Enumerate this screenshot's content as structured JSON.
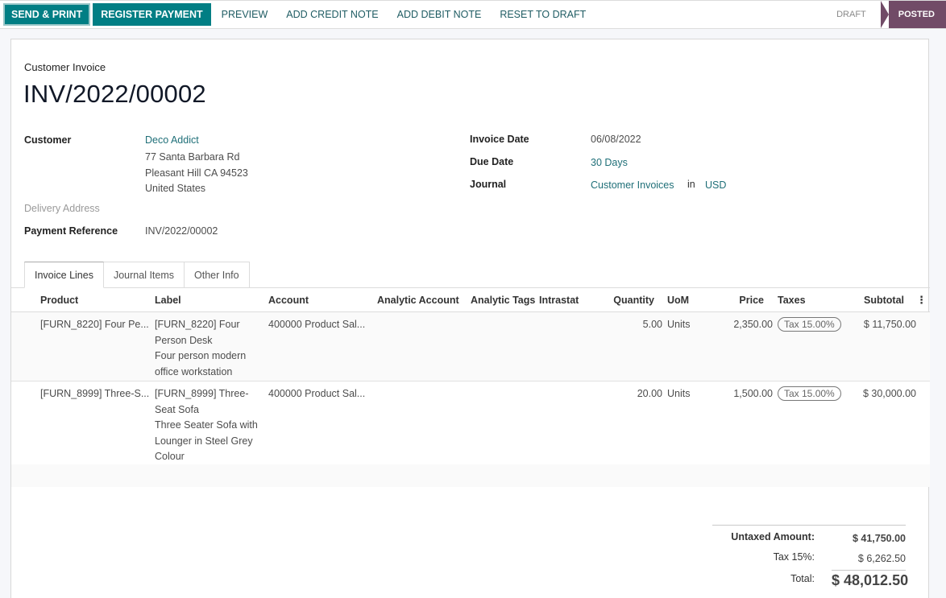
{
  "toolbar": {
    "send_print": "SEND & PRINT",
    "register_payment": "REGISTER PAYMENT",
    "preview": "PREVIEW",
    "add_credit_note": "ADD CREDIT NOTE",
    "add_debit_note": "ADD DEBIT NOTE",
    "reset_to_draft": "RESET TO DRAFT",
    "status_steps": [
      {
        "label": "DRAFT",
        "active": false
      },
      {
        "label": "POSTED",
        "active": true
      }
    ],
    "colors": {
      "primary": "#017e84",
      "status_active": "#714b67"
    }
  },
  "header": {
    "doc_type": "Customer Invoice",
    "title": "INV/2022/00002"
  },
  "fields": {
    "customer_label": "Customer",
    "customer_name": "Deco Addict",
    "address": [
      "77 Santa Barbara Rd",
      "Pleasant Hill CA 94523",
      "United States"
    ],
    "delivery_address_label": "Delivery Address",
    "payment_reference_label": "Payment Reference",
    "payment_reference": "INV/2022/00002",
    "invoice_date_label": "Invoice Date",
    "invoice_date": "06/08/2022",
    "due_date_label": "Due Date",
    "due_date": "30 Days",
    "journal_label": "Journal",
    "journal": "Customer Invoices",
    "journal_in": "in",
    "currency": "USD"
  },
  "tabs": [
    {
      "label": "Invoice Lines",
      "active": true
    },
    {
      "label": "Journal Items",
      "active": false
    },
    {
      "label": "Other Info",
      "active": false
    }
  ],
  "table": {
    "columns": [
      "Product",
      "Label",
      "Account",
      "Analytic Account",
      "Analytic Tags",
      "Intrastat",
      "Quantity",
      "UoM",
      "Price",
      "Taxes",
      "Subtotal"
    ],
    "rows": [
      {
        "product": "[FURN_8220] Four Pe...",
        "label": [
          "[FURN_8220] Four",
          "Person Desk",
          "Four person modern",
          "office workstation"
        ],
        "account": "400000 Product Sal...",
        "analytic_account": "",
        "analytic_tags": "",
        "intrastat": "",
        "quantity": "5.00",
        "uom": "Units",
        "price": "2,350.00",
        "taxes": "Tax 15.00%",
        "subtotal": "$ 11,750.00"
      },
      {
        "product": "[FURN_8999] Three-S...",
        "label": [
          "[FURN_8999] Three-",
          "Seat Sofa",
          "Three Seater Sofa with",
          "Lounger in Steel Grey",
          "Colour"
        ],
        "account": "400000 Product Sal...",
        "analytic_account": "",
        "analytic_tags": "",
        "intrastat": "",
        "quantity": "20.00",
        "uom": "Units",
        "price": "1,500.00",
        "taxes": "Tax 15.00%",
        "subtotal": "$ 30,000.00"
      }
    ]
  },
  "totals": {
    "untaxed_label": "Untaxed Amount:",
    "untaxed": "$ 41,750.00",
    "tax_label": "Tax 15%:",
    "tax": "$ 6,262.50",
    "total_label": "Total:",
    "total": "$ 48,012.50"
  }
}
